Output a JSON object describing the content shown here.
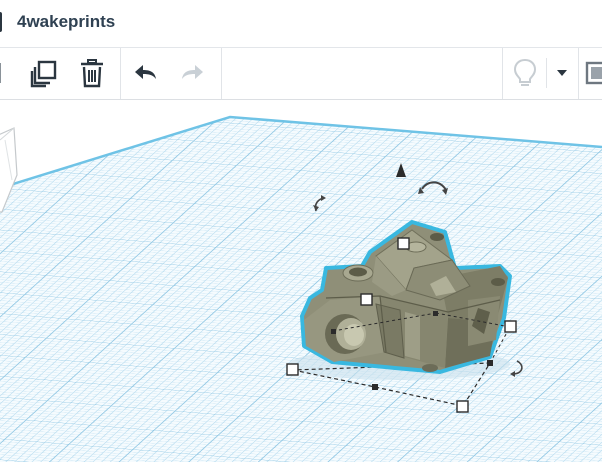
{
  "app": {
    "project_title": "4wakeprints"
  },
  "toolbar": {
    "buttons": [
      {
        "name": "paste",
        "icon": "paste-icon"
      },
      {
        "name": "duplicate",
        "icon": "duplicate-icon"
      },
      {
        "name": "delete",
        "icon": "trash-icon"
      },
      {
        "name": "undo",
        "icon": "undo-arrow-icon"
      },
      {
        "name": "redo",
        "icon": "redo-arrow-icon",
        "disabled": true
      },
      {
        "name": "notes",
        "icon": "lightbulb-icon"
      },
      {
        "name": "notes-dropdown",
        "icon": "caret-down-icon"
      },
      {
        "name": "view-panel",
        "icon": "panel-icon"
      }
    ]
  },
  "workplane": {
    "grid_color": "#a9d3e8",
    "plane_edge_color": "#6fc3e6"
  },
  "selected_shape": {
    "fill": "#8f8f78",
    "outline_color": "#39b8e0",
    "handle_color": "#ffffff"
  }
}
